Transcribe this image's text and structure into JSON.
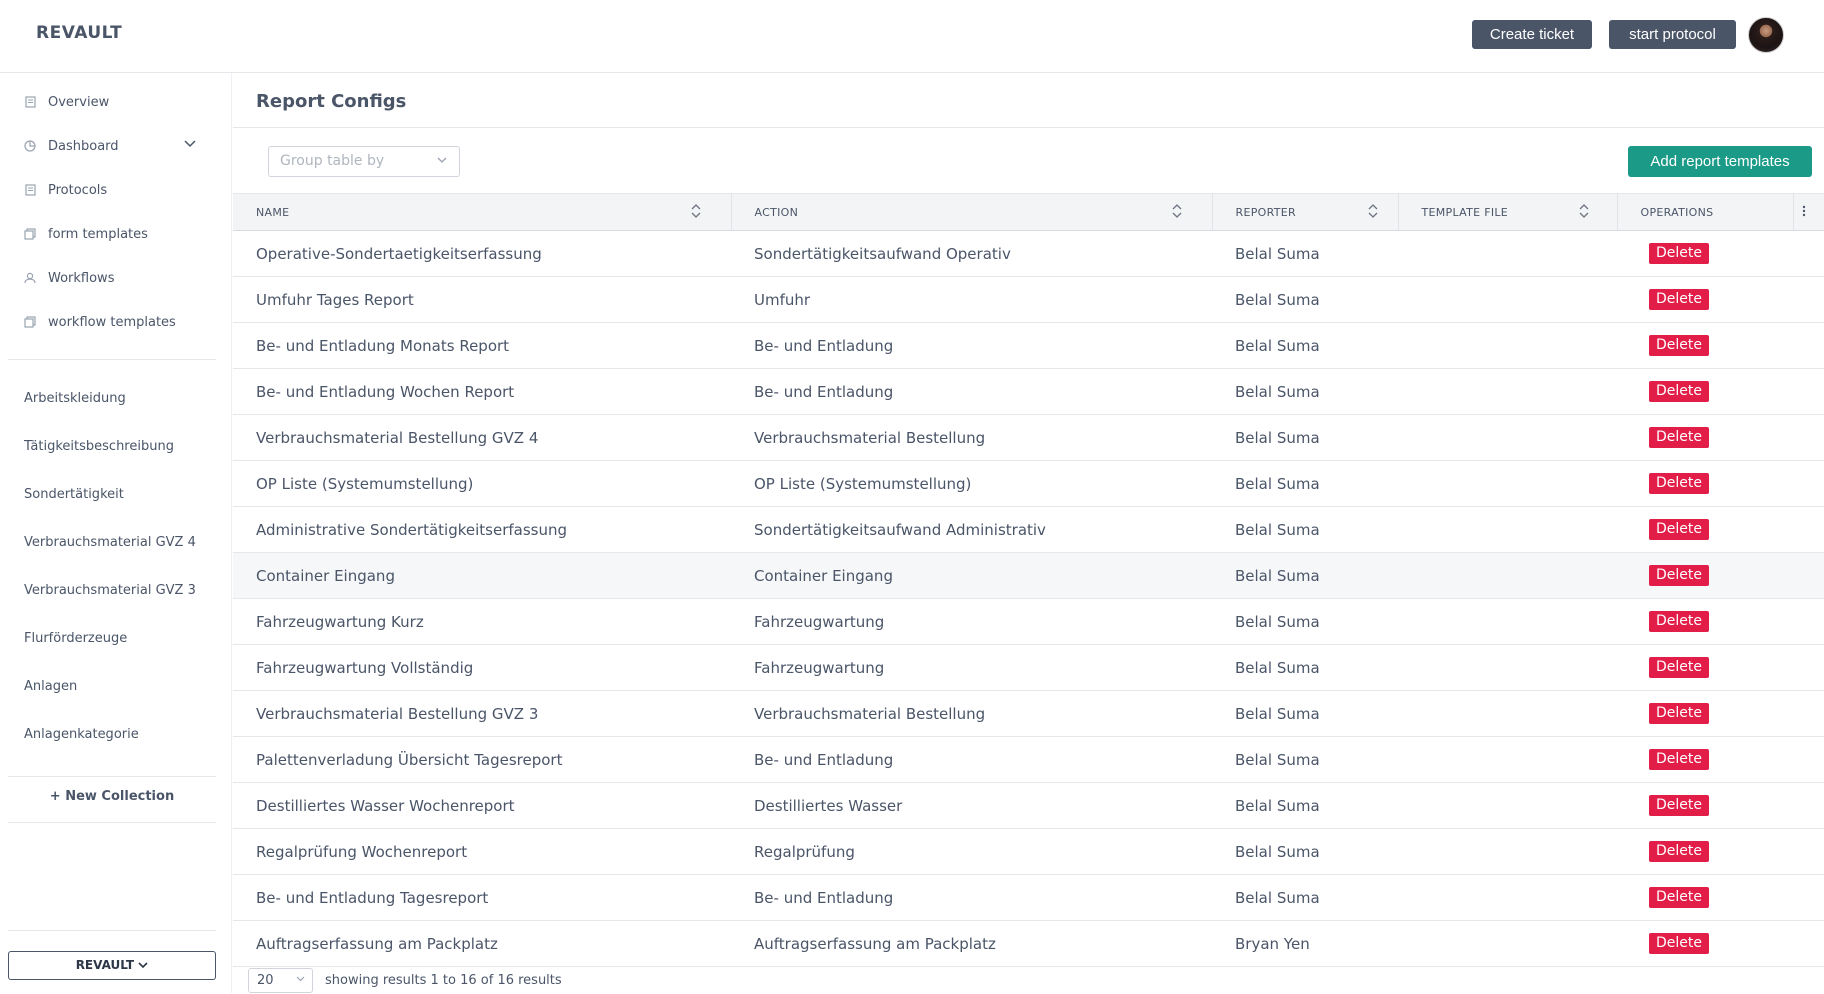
{
  "header": {
    "logo": "REVAULT",
    "create_ticket": "Create ticket",
    "start_protocol": "start protocol"
  },
  "sidebar": {
    "nav": [
      {
        "label": "Overview",
        "icon": "document-icon"
      },
      {
        "label": "Dashboard",
        "icon": "chart-pie-icon"
      },
      {
        "label": "Protocols",
        "icon": "document-icon"
      },
      {
        "label": "form templates",
        "icon": "copy-icon"
      },
      {
        "label": "Workflows",
        "icon": "user-icon"
      },
      {
        "label": "workflow templates",
        "icon": "copy-icon"
      }
    ],
    "collections": [
      "Arbeitskleidung",
      "Tätigkeitsbeschreibung",
      "Sondertätigkeit",
      "Verbrauchsmaterial GVZ 4",
      "Verbrauchsmaterial GVZ 3",
      "Flurförderzeuge",
      "Anlagen",
      "Anlagenkategorie"
    ],
    "new_collection": "+ New Collection",
    "workspace_selector": "REVAULT"
  },
  "main": {
    "title": "Report Configs",
    "group_by_placeholder": "Group table by",
    "add_button": "Add report templates",
    "columns": [
      "NAME",
      "ACTION",
      "REPORTER",
      "TEMPLATE FILE",
      "OPERATIONS"
    ],
    "delete_label": "Delete",
    "rows": [
      {
        "name": "Operative-Sondertaetigkeitserfassung",
        "action": "Sondertätigkeitsaufwand Operativ",
        "reporter": "Belal Suma",
        "template": ""
      },
      {
        "name": "Umfuhr Tages Report",
        "action": "Umfuhr",
        "reporter": "Belal Suma",
        "template": ""
      },
      {
        "name": "Be- und Entladung Monats Report",
        "action": "Be- und Entladung",
        "reporter": "Belal Suma",
        "template": ""
      },
      {
        "name": "Be- und Entladung Wochen Report",
        "action": "Be- und Entladung",
        "reporter": "Belal Suma",
        "template": ""
      },
      {
        "name": "Verbrauchsmaterial Bestellung GVZ 4",
        "action": "Verbrauchsmaterial Bestellung",
        "reporter": "Belal Suma",
        "template": ""
      },
      {
        "name": "OP Liste (Systemumstellung)",
        "action": "OP Liste (Systemumstellung)",
        "reporter": "Belal Suma",
        "template": ""
      },
      {
        "name": "Administrative Sondertätigkeitserfassung",
        "action": "Sondertätigkeitsaufwand Administrativ",
        "reporter": "Belal Suma",
        "template": ""
      },
      {
        "name": "Container Eingang",
        "action": "Container Eingang",
        "reporter": "Belal Suma",
        "template": ""
      },
      {
        "name": "Fahrzeugwartung Kurz",
        "action": "Fahrzeugwartung",
        "reporter": "Belal Suma",
        "template": ""
      },
      {
        "name": "Fahrzeugwartung Vollständig",
        "action": "Fahrzeugwartung",
        "reporter": "Belal Suma",
        "template": ""
      },
      {
        "name": "Verbrauchsmaterial Bestellung GVZ 3",
        "action": "Verbrauchsmaterial Bestellung",
        "reporter": "Belal Suma",
        "template": ""
      },
      {
        "name": "Palettenverladung Übersicht Tagesreport",
        "action": "Be- und Entladung",
        "reporter": "Belal Suma",
        "template": ""
      },
      {
        "name": "Destilliertes Wasser Wochenreport",
        "action": "Destilliertes Wasser",
        "reporter": "Belal Suma",
        "template": ""
      },
      {
        "name": "Regalprüfung Wochenreport",
        "action": "Regalprüfung",
        "reporter": "Belal Suma",
        "template": ""
      },
      {
        "name": "Be- und Entladung Tagesreport",
        "action": "Be- und Entladung",
        "reporter": "Belal Suma",
        "template": ""
      },
      {
        "name": "Auftragserfassung am Packplatz",
        "action": "Auftragserfassung am Packplatz",
        "reporter": "Bryan Yen",
        "template": ""
      }
    ],
    "page_size": "20",
    "showing_text": "showing results 1 to 16 of 16 results"
  },
  "colors": {
    "primary_dark": "#4a5568",
    "accent_teal": "#1a9a87",
    "delete_red": "#e11d48"
  }
}
